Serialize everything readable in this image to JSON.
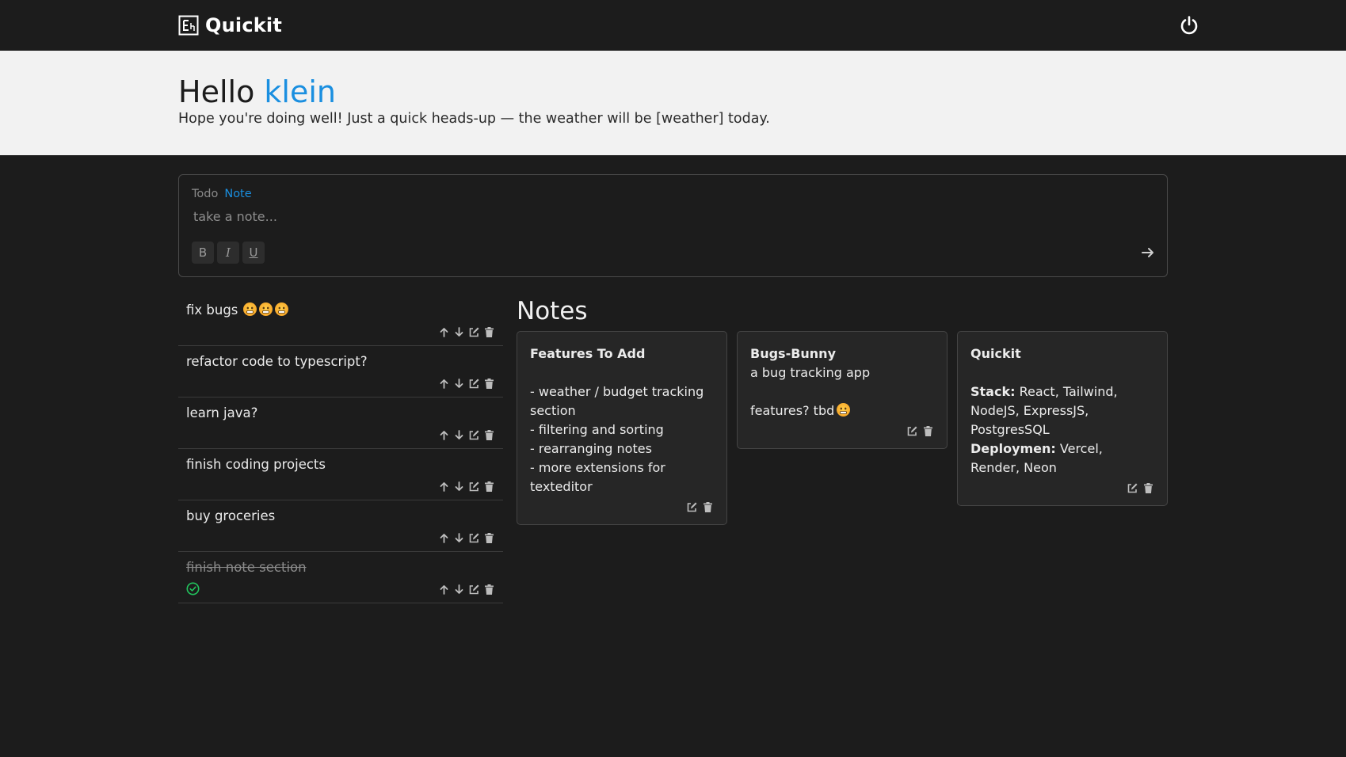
{
  "app": {
    "name": "Quickit",
    "logo_icon": "book-icon",
    "power_icon": "power-icon"
  },
  "greeting": {
    "hello": "Hello",
    "username": "klein",
    "message": "Hope you're doing well! Just a quick heads-up — the weather will be [weather] today."
  },
  "composer": {
    "tabs": [
      {
        "label": "Todo",
        "active": false
      },
      {
        "label": "Note",
        "active": true
      }
    ],
    "placeholder": "take a note...",
    "format_buttons": [
      "B",
      "I",
      "U"
    ],
    "send_icon": "arrow-right-icon"
  },
  "todos": [
    {
      "text": "fix bugs",
      "emoji_count": 3,
      "done": false
    },
    {
      "text": "refactor code to typescript?",
      "done": false
    },
    {
      "text": "learn java?",
      "done": false
    },
    {
      "text": "finish coding projects",
      "done": false
    },
    {
      "text": "buy groceries",
      "done": false
    },
    {
      "text": "finish note section",
      "done": true
    }
  ],
  "notes_section": {
    "title": "Notes",
    "cards": [
      {
        "title": "Features To Add",
        "lines": [
          "",
          "- weather / budget tracking section",
          "- filtering and sorting",
          "- rearranging notes",
          "- more extensions for texteditor"
        ]
      },
      {
        "title": "Bugs-Bunny",
        "lines": [
          "a bug tracking app",
          "",
          "features? tbd"
        ]
      },
      {
        "title": "Quickit",
        "lines": [
          "",
          "Stack:| React, Tailwind, NodeJS, ExpressJS, PostgresSQL",
          "Deploymen:| Vercel, Render, Neon"
        ]
      }
    ]
  },
  "colors": {
    "accent": "#1a8fe0",
    "background": "#1c1c1c",
    "hero": "#f2f2f2",
    "done": "#22c55e"
  }
}
